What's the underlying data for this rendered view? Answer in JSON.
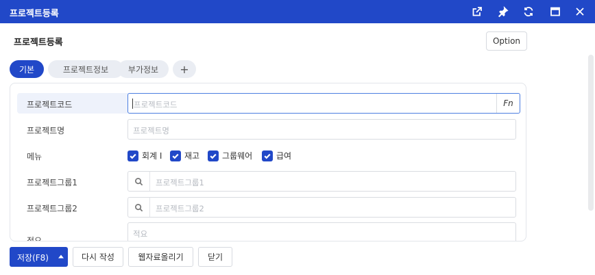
{
  "window": {
    "title": "프로젝트등록",
    "icons": [
      "external-link-icon",
      "pin-icon",
      "refresh-icon",
      "maximize-icon",
      "close-icon"
    ]
  },
  "header": {
    "page_title": "프로젝트등록",
    "option_label": "Option"
  },
  "tabs": [
    {
      "label": "기본",
      "active": true
    },
    {
      "label": "프로젝트정보",
      "active": false
    },
    {
      "label": "부가정보",
      "active": false
    },
    {
      "label": "+",
      "active": false
    }
  ],
  "form": {
    "project_code": {
      "label": "프로젝트코드",
      "placeholder": "프로젝트코드",
      "fn_label": "Fn"
    },
    "project_name": {
      "label": "프로젝트명",
      "placeholder": "프로젝트명"
    },
    "menu": {
      "label": "메뉴",
      "options": [
        {
          "label": "회계 I",
          "checked": true
        },
        {
          "label": "재고",
          "checked": true
        },
        {
          "label": "그룹웨어",
          "checked": true
        },
        {
          "label": "급여",
          "checked": true
        }
      ]
    },
    "project_group1": {
      "label": "프로젝트그룹1",
      "placeholder": "프로젝트그룹1"
    },
    "project_group2": {
      "label": "프로젝트그룹2",
      "placeholder": "프로젝트그룹2"
    },
    "remarks": {
      "label": "적요",
      "placeholder": "적요"
    }
  },
  "footer": {
    "save_label": "저장(F8)",
    "rewrite_label": "다시 작성",
    "upload_label": "웹자료올리기",
    "close_label": "닫기"
  },
  "colors": {
    "primary": "#2148c8",
    "tab_inactive": "#eaedf3",
    "row_highlight": "#eef2fb"
  }
}
